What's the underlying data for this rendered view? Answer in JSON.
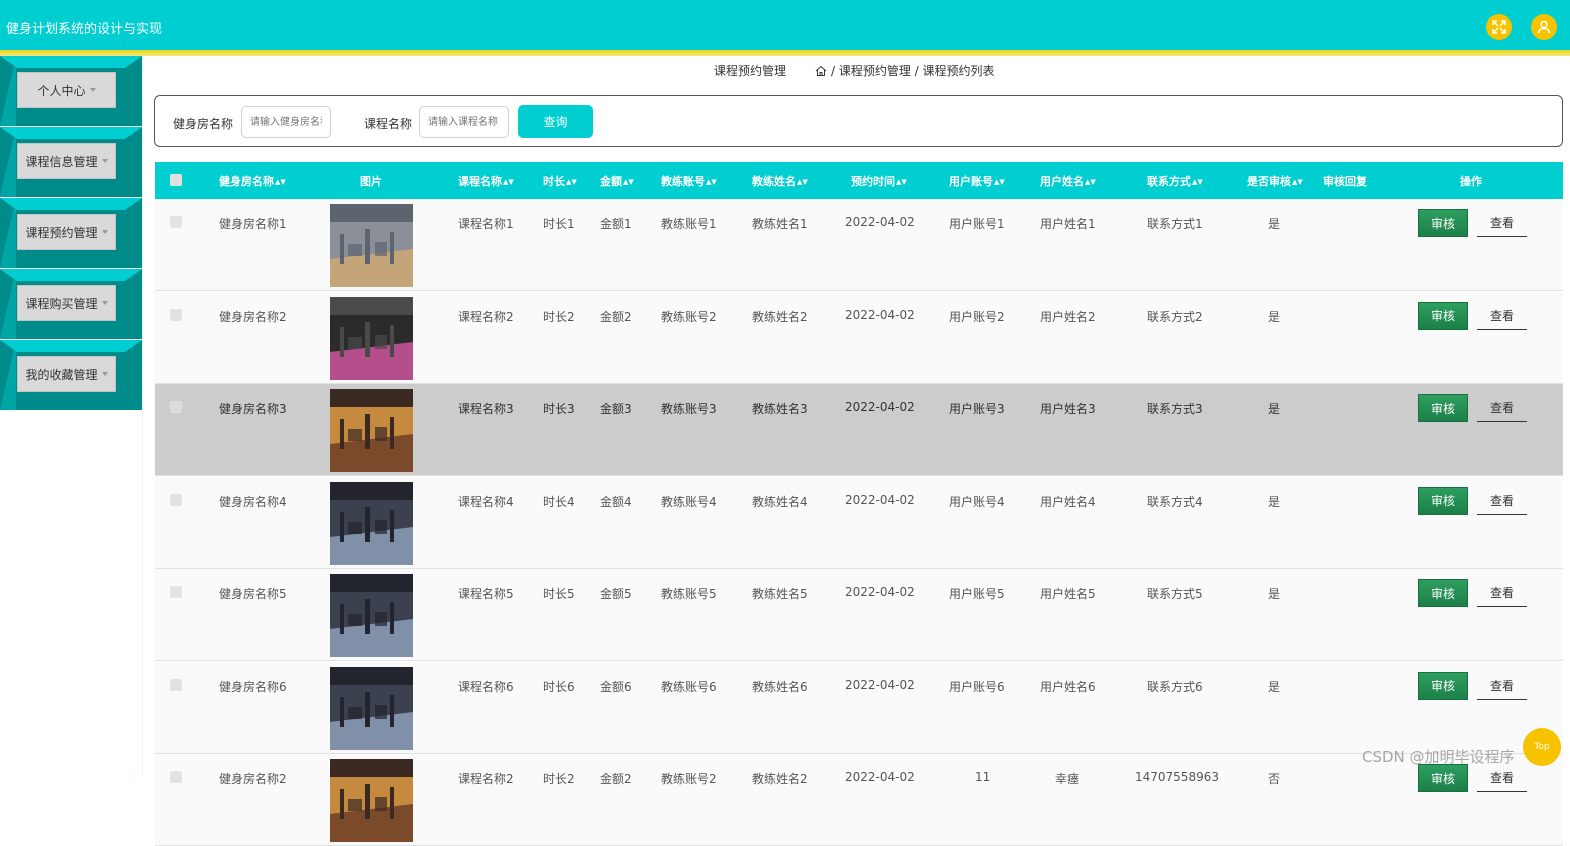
{
  "header": {
    "title": "健身计划系统的设计与实现",
    "fullscreen_icon": "expand-icon",
    "user_icon": "user-icon"
  },
  "sidebar": {
    "items": [
      {
        "label": "个人中心"
      },
      {
        "label": "课程信息管理"
      },
      {
        "label": "课程预约管理"
      },
      {
        "label": "课程购买管理"
      },
      {
        "label": "我的收藏管理"
      }
    ]
  },
  "breadcrumb": {
    "title": "课程预约管理",
    "path": "/ 课程预约管理 / 课程预约列表"
  },
  "search": {
    "gym_label": "健身房名称",
    "gym_placeholder": "请输入健身房名称",
    "course_label": "课程名称",
    "course_placeholder": "请输入课程名称",
    "button": "查询"
  },
  "table": {
    "headers": [
      "健身房名称",
      "图片",
      "课程名称",
      "时长",
      "金额",
      "教练账号",
      "教练姓名",
      "预约时间",
      "用户账号",
      "用户姓名",
      "联系方式",
      "是否审核",
      "审核回复",
      "操作"
    ],
    "rows": [
      {
        "gym": "健身房名称1",
        "course": "课程名称1",
        "duration": "时长1",
        "amount": "金额1",
        "coach_account": "教练账号1",
        "coach_name": "教练姓名1",
        "time": "2022-04-02",
        "user_account": "用户账号1",
        "user_name": "用户姓名1",
        "contact": "联系方式1",
        "audited": "是",
        "reply": ""
      },
      {
        "gym": "健身房名称2",
        "course": "课程名称2",
        "duration": "时长2",
        "amount": "金额2",
        "coach_account": "教练账号2",
        "coach_name": "教练姓名2",
        "time": "2022-04-02",
        "user_account": "用户账号2",
        "user_name": "用户姓名2",
        "contact": "联系方式2",
        "audited": "是",
        "reply": ""
      },
      {
        "gym": "健身房名称3",
        "course": "课程名称3",
        "duration": "时长3",
        "amount": "金额3",
        "coach_account": "教练账号3",
        "coach_name": "教练姓名3",
        "time": "2022-04-02",
        "user_account": "用户账号3",
        "user_name": "用户姓名3",
        "contact": "联系方式3",
        "audited": "是",
        "reply": ""
      },
      {
        "gym": "健身房名称4",
        "course": "课程名称4",
        "duration": "时长4",
        "amount": "金额4",
        "coach_account": "教练账号4",
        "coach_name": "教练姓名4",
        "time": "2022-04-02",
        "user_account": "用户账号4",
        "user_name": "用户姓名4",
        "contact": "联系方式4",
        "audited": "是",
        "reply": ""
      },
      {
        "gym": "健身房名称5",
        "course": "课程名称5",
        "duration": "时长5",
        "amount": "金额5",
        "coach_account": "教练账号5",
        "coach_name": "教练姓名5",
        "time": "2022-04-02",
        "user_account": "用户账号5",
        "user_name": "用户姓名5",
        "contact": "联系方式5",
        "audited": "是",
        "reply": ""
      },
      {
        "gym": "健身房名称6",
        "course": "课程名称6",
        "duration": "时长6",
        "amount": "金额6",
        "coach_account": "教练账号6",
        "coach_name": "教练姓名6",
        "time": "2022-04-02",
        "user_account": "用户账号6",
        "user_name": "用户姓名6",
        "contact": "联系方式6",
        "audited": "是",
        "reply": ""
      },
      {
        "gym": "健身房名称2",
        "course": "课程名称2",
        "duration": "时长2",
        "amount": "金额2",
        "coach_account": "教练账号2",
        "coach_name": "教练姓名2",
        "time": "2022-04-02",
        "user_account": "11",
        "user_name": "幸瘗",
        "contact": "14707558963",
        "audited": "否",
        "reply": ""
      }
    ],
    "actions": {
      "audit": "审核",
      "view": "查看"
    }
  },
  "footer": {
    "watermark": "CSDN @加明毕设程序",
    "top_button": "Top"
  },
  "colors": {
    "primary": "#00ced1",
    "sidebar_dark": "#008b8b",
    "accent_yellow": "#f7c200",
    "audit_green": "#1c8048",
    "highlight_row": "#cccccc"
  }
}
